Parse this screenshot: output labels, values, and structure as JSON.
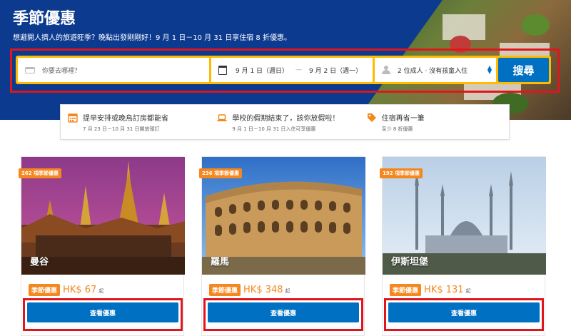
{
  "hero": {
    "title": "季節優惠",
    "subtitle": "想避開人擠人的旅遊旺季？晚點出發剛剛好！9 月 1 日－10 月 31 日享住宿 8 折優惠。"
  },
  "search": {
    "destination_placeholder": "你要去哪裡？",
    "checkin": "9 月 1 日（週日）",
    "date_separator": "—",
    "checkout": "9 月 2 日（週一）",
    "guests": "2 位成人 · 沒有孩童入住",
    "button_label": "搜尋"
  },
  "info_items": [
    {
      "title": "提早安排或晚鳥訂房都能省",
      "subtitle": "7 月 23 日－10 月 31 日開放預訂",
      "icon": "calendar-icon"
    },
    {
      "title": "學校的假期結束了，該你放假啦！",
      "subtitle": "9 月 1 日－10 月 31 日入住可享優惠",
      "icon": "laptop-icon"
    },
    {
      "title": "住宿再省一筆",
      "subtitle": "至少 8 折優惠",
      "icon": "tag-icon"
    }
  ],
  "cards": [
    {
      "badge": "262 項季節優惠",
      "city": "曼谷",
      "deal_tag": "季節優惠",
      "price": "HK$ 67",
      "price_unit": "起",
      "button_label": "查看優惠"
    },
    {
      "badge": "236 項季節優惠",
      "city": "羅馬",
      "deal_tag": "季節優惠",
      "price": "HK$ 348",
      "price_unit": "起",
      "button_label": "查看優惠"
    },
    {
      "badge": "192 項季節優惠",
      "city": "伊斯坦堡",
      "deal_tag": "季節優惠",
      "price": "HK$ 131",
      "price_unit": "起",
      "button_label": "查看優惠"
    }
  ],
  "colors": {
    "brand_blue": "#0071c2",
    "hero_blue": "#0b3a8f",
    "search_yellow": "#febb02",
    "accent_orange": "#f5871f",
    "highlight_red": "#e0161c"
  }
}
